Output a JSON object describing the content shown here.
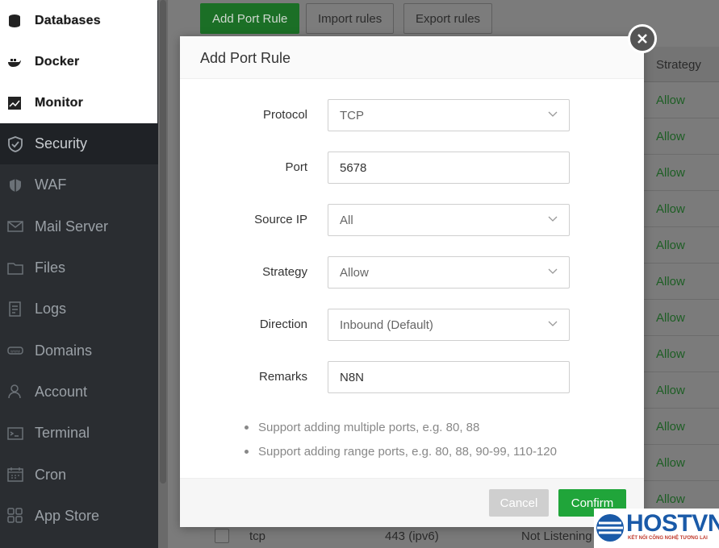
{
  "sidebar": {
    "top_items": [
      {
        "label": "Databases",
        "icon": "database-icon"
      },
      {
        "label": "Docker",
        "icon": "docker-icon"
      },
      {
        "label": "Monitor",
        "icon": "monitor-icon"
      }
    ],
    "items": [
      {
        "label": "Security",
        "icon": "shield-icon",
        "active": true
      },
      {
        "label": "WAF",
        "icon": "waf-shield-icon"
      },
      {
        "label": "Mail Server",
        "icon": "mail-icon"
      },
      {
        "label": "Files",
        "icon": "folder-icon"
      },
      {
        "label": "Logs",
        "icon": "logs-icon"
      },
      {
        "label": "Domains",
        "icon": "domains-icon"
      },
      {
        "label": "Account",
        "icon": "account-icon"
      },
      {
        "label": "Terminal",
        "icon": "terminal-icon"
      },
      {
        "label": "Cron",
        "icon": "calendar-icon"
      },
      {
        "label": "App Store",
        "icon": "app-store-icon"
      }
    ]
  },
  "toolbar": {
    "add_label": "Add Port Rule",
    "import_label": "Import rules",
    "export_label": "Export rules"
  },
  "table": {
    "strategy_header": "Strategy",
    "strategy_values": [
      "Allow",
      "Allow",
      "Allow",
      "Allow",
      "Allow",
      "Allow",
      "Allow",
      "Allow",
      "Allow",
      "Allow",
      "Allow",
      "Allow"
    ],
    "bottom_row": {
      "protocol": "tcp",
      "port": "443 (ipv6)",
      "status": "Not Listening"
    }
  },
  "modal": {
    "title": "Add Port Rule",
    "fields": {
      "protocol": {
        "label": "Protocol",
        "value": "TCP"
      },
      "port": {
        "label": "Port",
        "value": "5678"
      },
      "source_ip": {
        "label": "Source IP",
        "value": "All"
      },
      "strategy": {
        "label": "Strategy",
        "value": "Allow"
      },
      "direction": {
        "label": "Direction",
        "value": "Inbound (Default)"
      },
      "remarks": {
        "label": "Remarks",
        "value": "N8N"
      }
    },
    "tips": [
      "Support adding multiple ports, e.g. 80, 88",
      "Support adding range ports, e.g. 80, 88, 90-99, 110-120"
    ],
    "cancel_label": "Cancel",
    "confirm_label": "Confirm"
  },
  "watermark": {
    "brand": "HOSTVN",
    "tagline": "KẾT NỐI CÔNG NGHỆ TƯƠNG LAI"
  },
  "colors": {
    "accent": "#20a53a",
    "sidebar_bg": "#2a2d31",
    "allow_text": "#1d5e24"
  }
}
